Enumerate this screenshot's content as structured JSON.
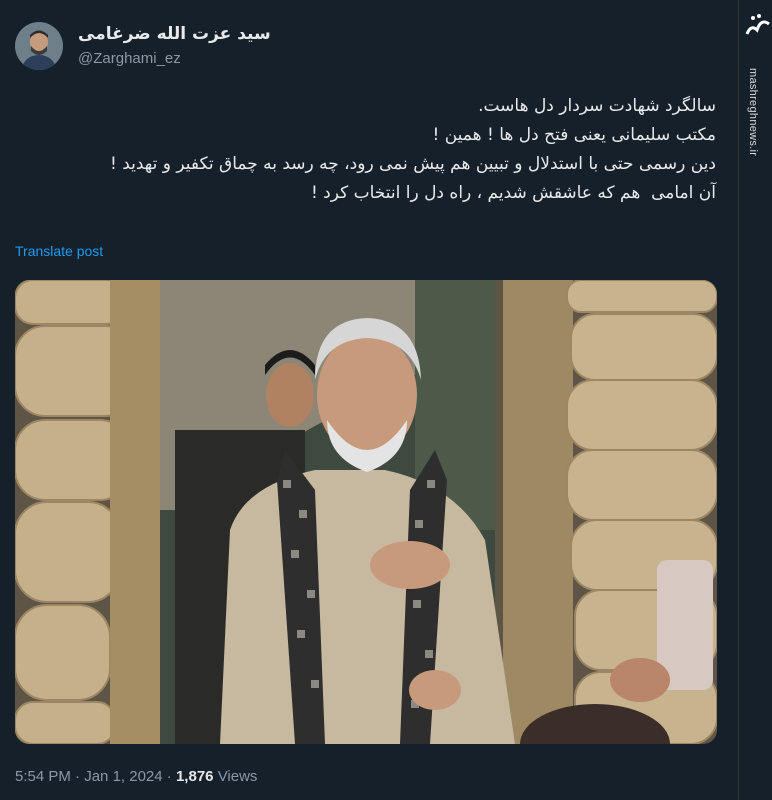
{
  "author": {
    "name": "سید عزت الله ضرغامی",
    "handle": "@Zarghami_ez"
  },
  "tweet": {
    "lines": [
      "سالگرد شهادت سردار دل هاست.",
      "مکتب سلیمانی یعنی فتح دل ها ! همین !",
      "دین رسمی حتی با استدلال و تبیین هم پیش نمی رود، چه رسد به چماق تکفیر و تهدید !",
      "آن امامی  هم که عاشقش شدیم ، راه دل را انتخاب کرد !"
    ],
    "translate_label": "Translate post"
  },
  "meta": {
    "time": "5:54 PM",
    "separator": "·",
    "date": "Jan 1, 2024",
    "views_count": "1,876",
    "views_label": "Views"
  },
  "watermark": {
    "site": "mashreghnews.ir",
    "logo": "مشرق"
  },
  "colors": {
    "background": "#15202b",
    "text": "#e7e9ea",
    "secondary": "#8b98a5",
    "link": "#1d9bf0"
  }
}
